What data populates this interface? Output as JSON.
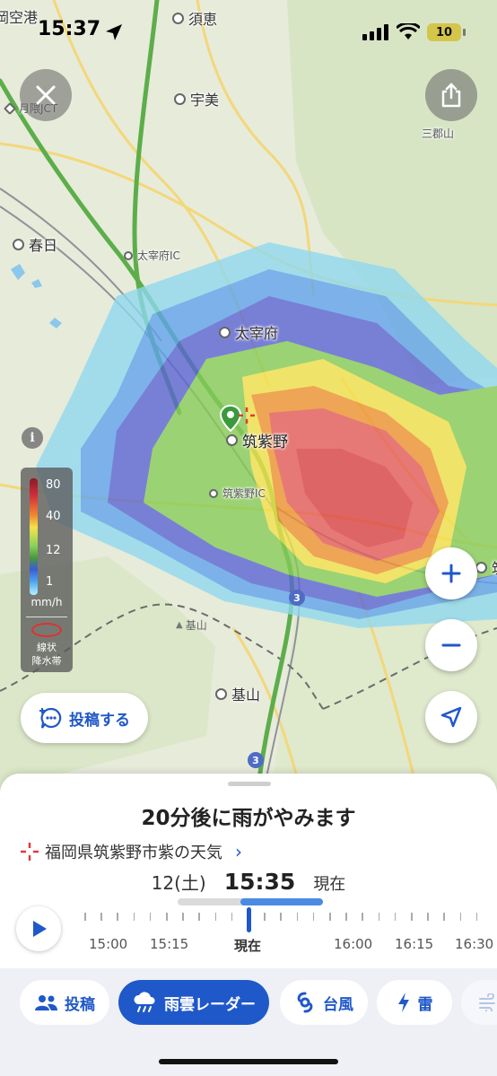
{
  "status_bar": {
    "time": "15:37",
    "battery": "10"
  },
  "map": {
    "places": {
      "fukuoka_airport": "岡空港",
      "suki": "須恵",
      "umi": "宇美",
      "tsukigumajct": "月隈JCT",
      "sangunzan": "三郡山",
      "kasuga": "春日",
      "dazaifu_ic": "太宰府IC",
      "dazaifu": "太宰府",
      "chikushino": "筑紫野",
      "chikushino_ic": "筑紫野IC",
      "kiyama_mt": "基山",
      "kiyama": "基山",
      "chiku_edge": "筑"
    },
    "route_numbers": [
      "3",
      "3"
    ]
  },
  "legend": {
    "ticks": [
      "80",
      "40",
      "12",
      "1"
    ],
    "unit": "mm/h",
    "linear_band": "線状\n降水帯"
  },
  "buttons": {
    "info": "i",
    "post": "投稿する"
  },
  "sheet": {
    "headline": "20分後に雨がやみます",
    "location": "福岡県筑紫野市紫の天気",
    "date": "12(土)",
    "time": "15:35",
    "now_label": "現在",
    "timeline_labels": [
      "15:00",
      "15:15",
      "現在",
      "16:00",
      "16:15",
      "16:30"
    ]
  },
  "tabs": [
    {
      "label": "投稿",
      "icon": "people-icon"
    },
    {
      "label": "雨雲レーダー",
      "icon": "rain-cloud-icon",
      "active": true
    },
    {
      "label": "台風",
      "icon": "typhoon-icon"
    },
    {
      "label": "雷",
      "icon": "lightning-icon"
    }
  ],
  "colors": {
    "accent": "#1f58c9"
  }
}
